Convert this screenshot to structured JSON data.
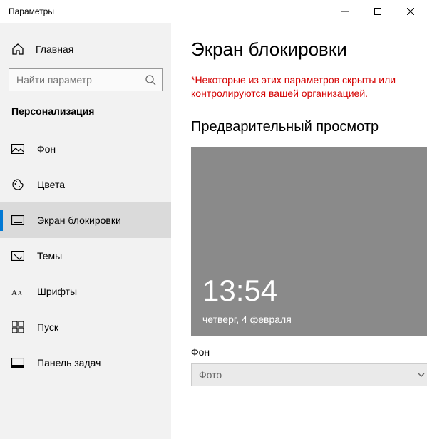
{
  "window": {
    "title": "Параметры"
  },
  "sidebar": {
    "home_label": "Главная",
    "search_placeholder": "Найти параметр",
    "category": "Персонализация",
    "items": [
      {
        "label": "Фон"
      },
      {
        "label": "Цвета"
      },
      {
        "label": "Экран блокировки"
      },
      {
        "label": "Темы"
      },
      {
        "label": "Шрифты"
      },
      {
        "label": "Пуск"
      },
      {
        "label": "Панель задач"
      }
    ]
  },
  "main": {
    "title": "Экран блокировки",
    "warning": "*Некоторые из этих параметров скрыты или контролируются вашей организацией.",
    "preview_section_title": "Предварительный просмотр",
    "preview": {
      "time": "13:54",
      "date": "четверг, 4 февраля"
    },
    "background_field_label": "Фон",
    "background_dropdown_value": "Фото"
  }
}
